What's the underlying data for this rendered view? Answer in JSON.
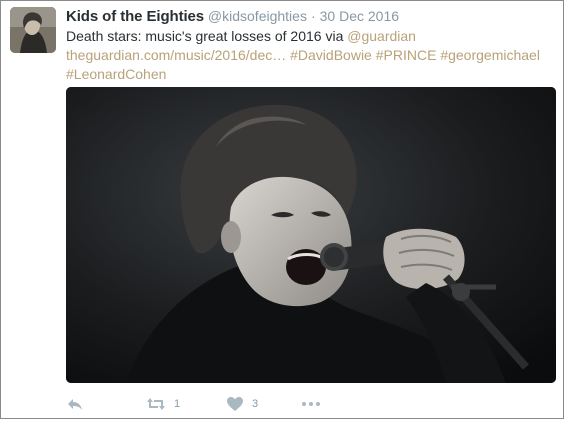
{
  "tweet": {
    "display_name": "Kids of the Eighties",
    "handle": "@kidsofeighties",
    "separator": "·",
    "date": "30 Dec 2016",
    "text_prefix": "Death stars: music's great losses of 2016 via ",
    "mention": "@guardian",
    "url": "theguardian.com/music/2016/dec…",
    "hashtags": [
      "#DavidBowie",
      "#PRINCE",
      "#georgemichael",
      "#LeonardCohen"
    ]
  },
  "actions": {
    "reply_icon": "reply-icon",
    "retweet_icon": "retweet-icon",
    "retweet_count": "1",
    "like_icon": "heart-icon",
    "like_count": "3",
    "more_icon": "more-dots-icon"
  },
  "colors": {
    "link": "#b9a27a",
    "text": "#292f33",
    "muted": "#8899a6"
  }
}
